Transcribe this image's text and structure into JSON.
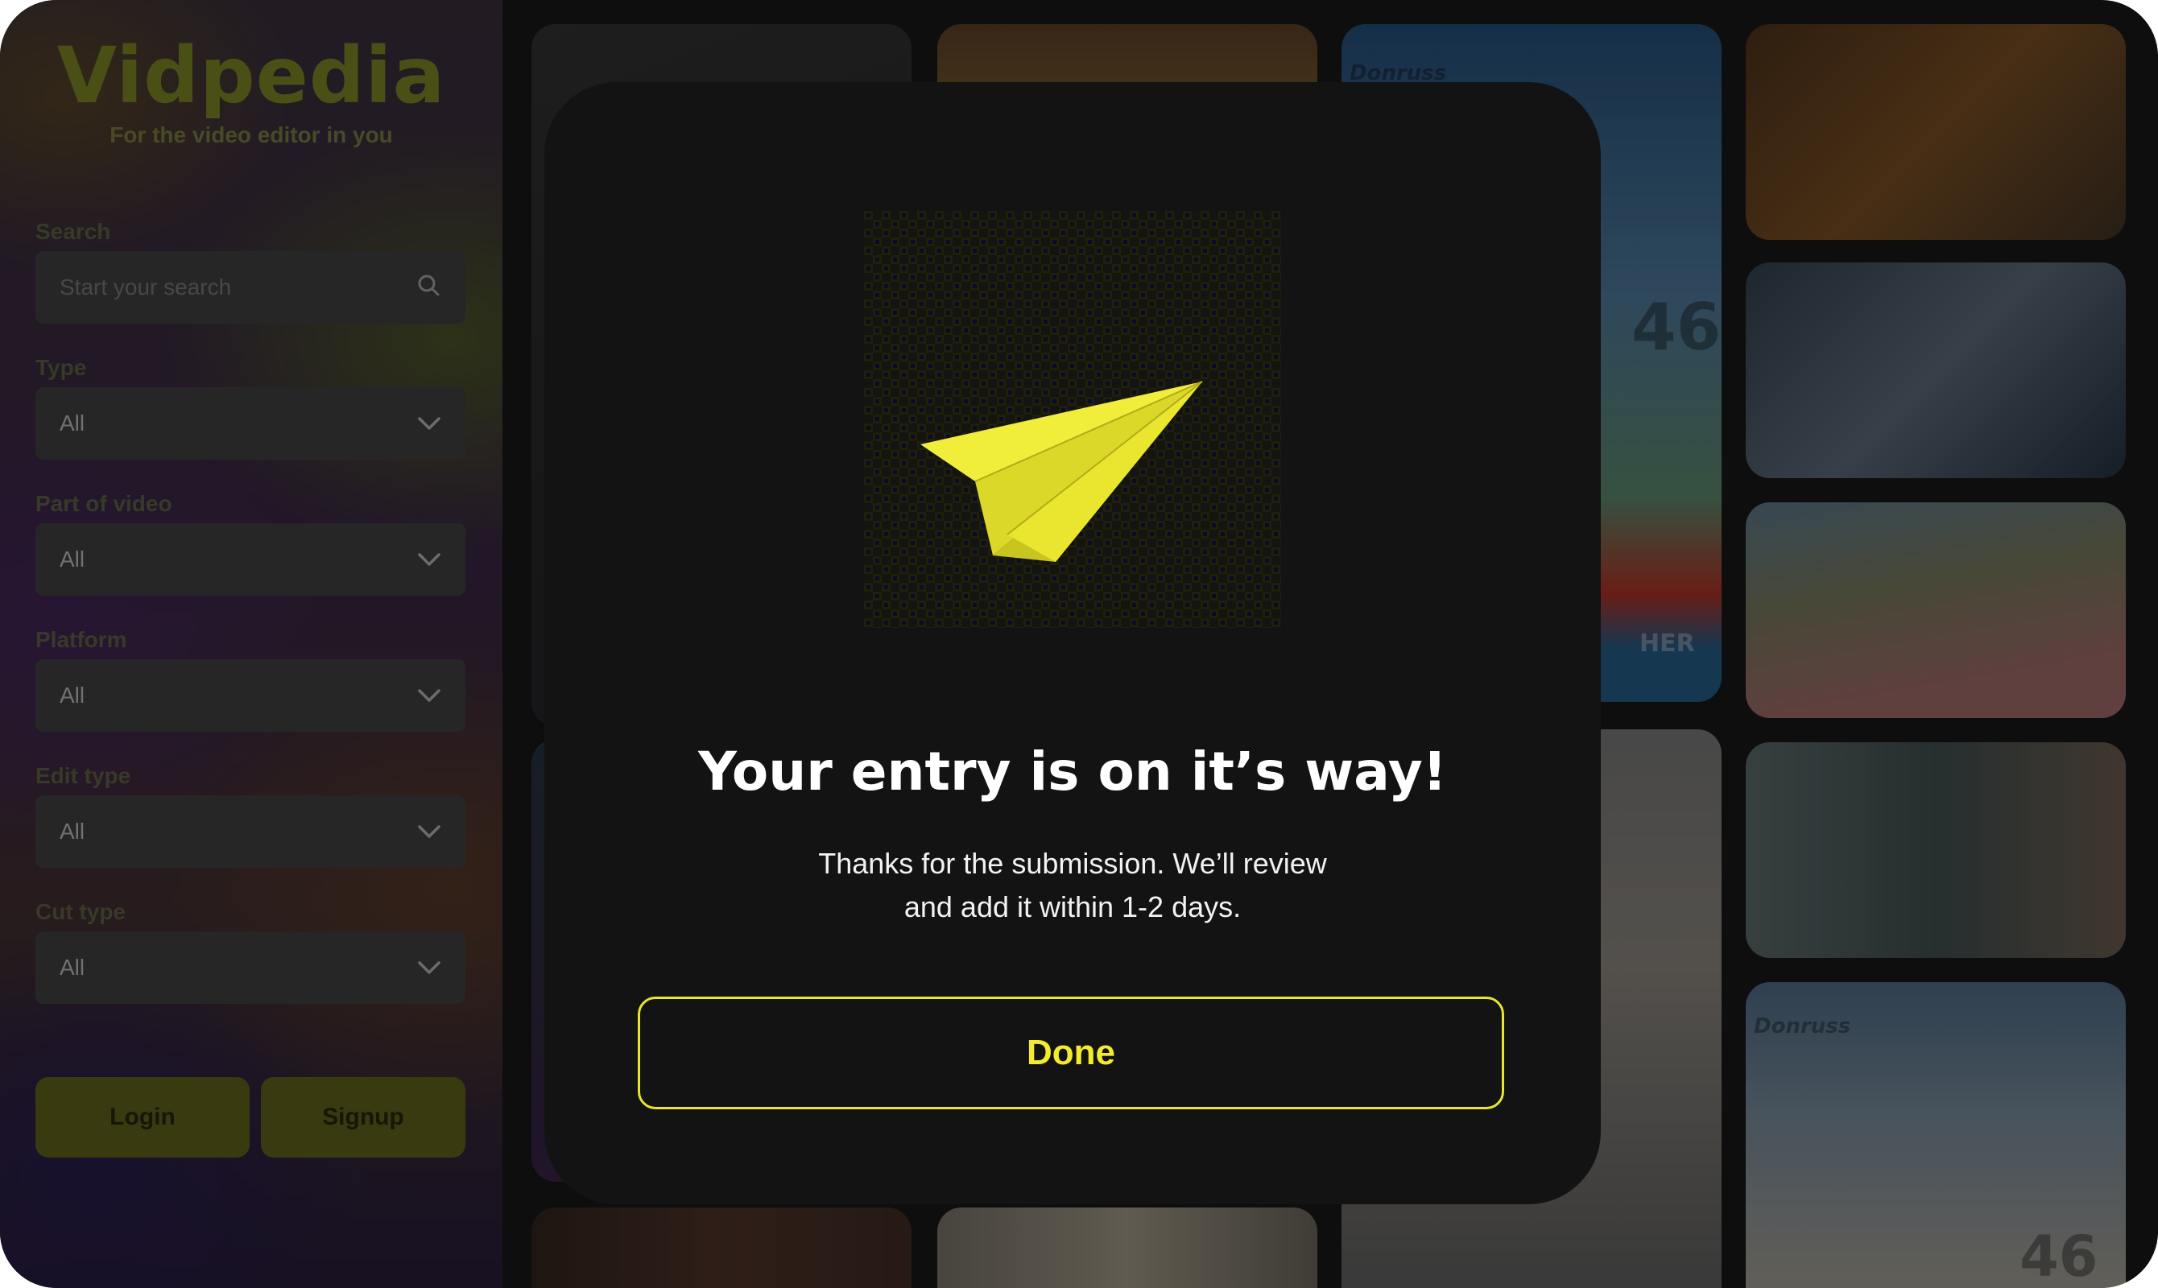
{
  "app": {
    "logo": "Vidpedia",
    "tagline": "For the video editor in you"
  },
  "sidebar": {
    "search": {
      "label": "Search",
      "placeholder": "Start your search",
      "icon": "search-icon"
    },
    "filters": [
      {
        "label": "Type",
        "value": "All"
      },
      {
        "label": "Part of video",
        "value": "All"
      },
      {
        "label": "Platform",
        "value": "All"
      },
      {
        "label": "Edit type",
        "value": "All"
      },
      {
        "label": "Cut type",
        "value": "All"
      }
    ],
    "login_label": "Login",
    "signup_label": "Signup"
  },
  "grid": {
    "card_brand": "Donruss",
    "card_number": "46",
    "card_name_fragment": "HER"
  },
  "modal": {
    "illustration": "paper-plane-icon",
    "title": "Your entry is on it’s way!",
    "body_line1": "Thanks for the submission. We’ll review",
    "body_line2": "and add it within 1-2 days.",
    "done_label": "Done"
  },
  "colors": {
    "accent": "#f2ec2c",
    "modal_bg": "#131313",
    "sidebar_button": "#6e6f1e"
  }
}
